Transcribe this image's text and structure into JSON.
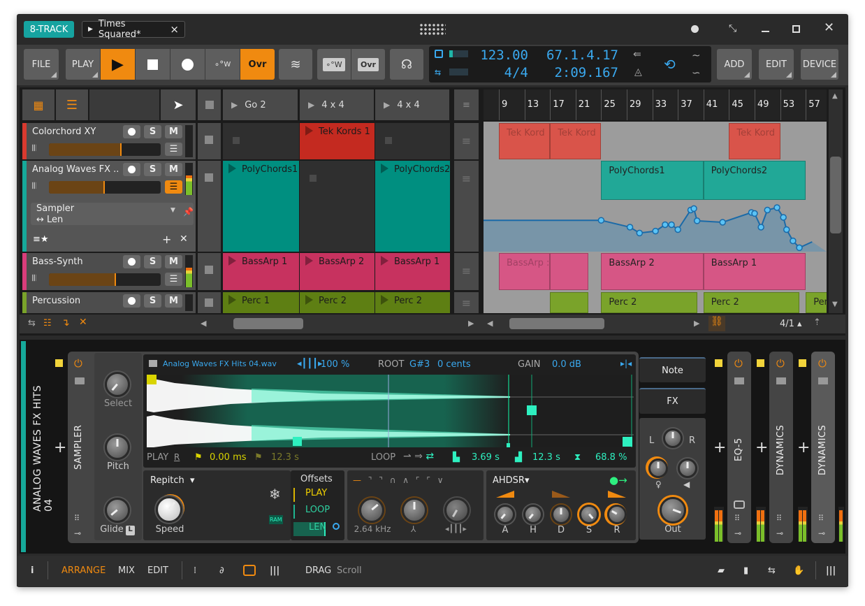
{
  "titlebar": {
    "project_button": "8-TRACK",
    "tab": "Times Squared*",
    "tab_close": "×"
  },
  "toolbar": {
    "file": "FILE",
    "play_menu": "PLAY",
    "ovr": "Ovr",
    "ovr2": "Ovr",
    "tempo": "123.00",
    "time_signature": "4/4",
    "position_bars": "67.1.4.17",
    "position_time": "2:09.167",
    "add": "ADD",
    "edit": "EDIT",
    "device": "DEVICE",
    "w": "W"
  },
  "tracks": [
    {
      "name": "Colorchord XY",
      "color": "#d93a2f",
      "volume": 0.65
    },
    {
      "name": "Analog Waves FX ...",
      "color": "#16a99a",
      "volume": 0.5
    },
    {
      "name": "Bass-Synth",
      "color": "#d93d7b",
      "volume": 0.6
    },
    {
      "name": "Percussion",
      "color": "#7aa32a",
      "volume": 0.6
    }
  ],
  "track_buttons": {
    "solo": "S",
    "mute": "M"
  },
  "device_selector": {
    "name": "Sampler",
    "param": "↔ Len"
  },
  "scenes": [
    "Go 2",
    "4 x 4",
    "4 x 4"
  ],
  "launcher_clips": [
    [
      null,
      "Tek Kords 1",
      null
    ],
    [
      "PolyChords1",
      null,
      "PolyChords2"
    ],
    [
      "BassArp 1",
      "BassArp 2",
      "BassArp 1"
    ],
    [
      "Perc 1",
      "Perc 2",
      "Perc 2"
    ]
  ],
  "ruler": [
    "9",
    "13",
    "17",
    "21",
    "25",
    "29",
    "33",
    "37",
    "41",
    "45",
    "49",
    "53",
    "57"
  ],
  "arrangement_clips": [
    {
      "track": 0,
      "start": 9,
      "end": 17,
      "label": "Tek Kord"
    },
    {
      "track": 0,
      "start": 17,
      "end": 25,
      "label": "Tek Kord"
    },
    {
      "track": 0,
      "start": 45,
      "end": 53,
      "label": "Tek Kord"
    },
    {
      "track": 1,
      "start": 25,
      "end": 41,
      "label": "PolyChords1"
    },
    {
      "track": 1,
      "start": 41,
      "end": 57,
      "label": "PolyChords2"
    },
    {
      "track": 2,
      "start": 9,
      "end": 17,
      "label": "BassArp :"
    },
    {
      "track": 2,
      "start": 17,
      "end": 23,
      "label": ""
    },
    {
      "track": 2,
      "start": 25,
      "end": 41,
      "label": "BassArp 2"
    },
    {
      "track": 2,
      "start": 41,
      "end": 57,
      "label": "BassArp 1"
    },
    {
      "track": 3,
      "start": 17,
      "end": 23,
      "label": ""
    },
    {
      "track": 3,
      "start": 25,
      "end": 40,
      "label": "Perc 2"
    },
    {
      "track": 3,
      "start": 41,
      "end": 56,
      "label": "Perc 2"
    },
    {
      "track": 3,
      "start": 57,
      "end": 62,
      "label": "Per"
    }
  ],
  "automation": [
    [
      6,
      0.64
    ],
    [
      25,
      0.64
    ],
    [
      29.5,
      0.5
    ],
    [
      31,
      0.38
    ],
    [
      33.5,
      0.42
    ],
    [
      35,
      0.55
    ],
    [
      36,
      0.55
    ],
    [
      37,
      0.45
    ],
    [
      39,
      0.85
    ],
    [
      39.5,
      0.88
    ],
    [
      40,
      0.63
    ],
    [
      44,
      0.6
    ],
    [
      48.5,
      0.8
    ],
    [
      49,
      0.78
    ],
    [
      50,
      0.5
    ],
    [
      51,
      0.85
    ],
    [
      52.5,
      0.9
    ],
    [
      53.5,
      0.7
    ],
    [
      54,
      0.45
    ],
    [
      55,
      0.22
    ],
    [
      56,
      0.08
    ],
    [
      58,
      0.2
    ]
  ],
  "arranger_footer": {
    "grid": "4/1"
  },
  "device_chain": {
    "track_label": "ANALOG WAVES FX HITS 04",
    "sampler": "SAMPLER",
    "eq": "EQ-5",
    "dyn1": "DYNAMICS",
    "dyn2": "DYNAMICS"
  },
  "sampler": {
    "select": "Select",
    "pitch": "Pitch",
    "glide": "Glide",
    "glide_badge": "L",
    "file": "Analog Waves FX Hits 04.wav",
    "zoom": "100 %",
    "root_label": "ROOT",
    "root": "G#3",
    "cents": "0 cents",
    "gain_label": "GAIN",
    "gain": "0.0 dB",
    "play_label": "PLAY",
    "r": "R",
    "start": "0.00 ms",
    "end": "12.3 s",
    "loop_label": "LOOP",
    "loop_start": "3.69 s",
    "loop_end": "12.3 s",
    "crossfade": "68.8 %",
    "mode": "Repitch",
    "speed": "Speed",
    "ram": "RAM",
    "offsets": "Offsets",
    "off_play": "PLAY",
    "off_loop": "LOOP",
    "off_len": "LEN",
    "cutoff": "2.64 kHz",
    "env": "AHDSR",
    "a": "A",
    "h": "H",
    "d": "D",
    "s": "S",
    "r_env": "R",
    "note": "Note",
    "fx": "FX",
    "l": "L",
    "rr": "R",
    "out": "Out"
  },
  "footer": {
    "arrange": "ARRANGE",
    "mix": "MIX",
    "edit": "EDIT",
    "drag": "DRAG",
    "scroll": "Scroll"
  },
  "colors": {
    "accent": "#f08a10",
    "lcd": "#3aa9ef",
    "teal": "#16a99a"
  }
}
